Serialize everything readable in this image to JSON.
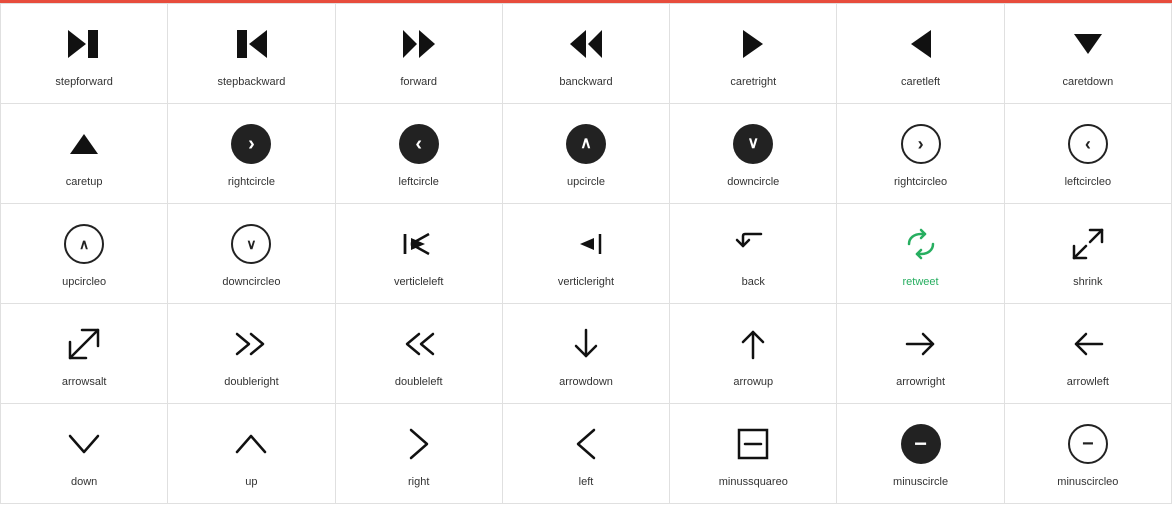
{
  "icons": [
    {
      "id": "stepforward",
      "label": "stepforward",
      "type": "text",
      "symbol": "⏭",
      "unicode": "&#x23ED;"
    },
    {
      "id": "stepbackward",
      "label": "stepbackward",
      "type": "text",
      "symbol": "⏮",
      "unicode": "&#x23EE;"
    },
    {
      "id": "forward",
      "label": "forward",
      "type": "text",
      "symbol": "⏩",
      "unicode": "&#x23E9;"
    },
    {
      "id": "banckward",
      "label": "banckward",
      "type": "text",
      "symbol": "⏪",
      "unicode": "&#x23EA;"
    },
    {
      "id": "caretright",
      "label": "caretright",
      "type": "text",
      "symbol": "▶",
      "unicode": "&#x25B6;"
    },
    {
      "id": "caretleft",
      "label": "caretleft",
      "type": "text",
      "symbol": "◀",
      "unicode": "&#x25C0;"
    },
    {
      "id": "caretdown",
      "label": "caretdown",
      "type": "text",
      "symbol": "▼",
      "unicode": "&#x25BC;"
    },
    {
      "id": "caretup",
      "label": "caretup",
      "type": "text",
      "symbol": "▲",
      "unicode": "&#x25B2;"
    },
    {
      "id": "rightcircle",
      "label": "rightcircle",
      "type": "filled-circle",
      "symbol": "❯"
    },
    {
      "id": "leftcircle",
      "label": "leftcircle",
      "type": "filled-circle",
      "symbol": "❮"
    },
    {
      "id": "upcircle",
      "label": "upcircle",
      "type": "filled-circle",
      "symbol": "❮",
      "rotate": "-90"
    },
    {
      "id": "downcircle",
      "label": "downcircle",
      "type": "filled-circle",
      "symbol": "❯",
      "rotate": "90"
    },
    {
      "id": "rightcircleo",
      "label": "rightcircleo",
      "type": "outline-circle",
      "symbol": "❯"
    },
    {
      "id": "leftcircleo",
      "label": "leftcircleo",
      "type": "outline-circle",
      "symbol": "❮"
    },
    {
      "id": "upcircleo",
      "label": "upcircleo",
      "type": "outline-circle",
      "symbol": "∧"
    },
    {
      "id": "downcircleo",
      "label": "downcircleo",
      "type": "outline-circle",
      "symbol": "∨"
    },
    {
      "id": "verticleleft",
      "label": "verticleleft",
      "type": "text",
      "symbol": "⇤"
    },
    {
      "id": "verticleright",
      "label": "verticleright",
      "type": "text",
      "symbol": "⇥"
    },
    {
      "id": "back",
      "label": "back",
      "type": "text",
      "symbol": "↩"
    },
    {
      "id": "retweet",
      "label": "retweet",
      "type": "retweet",
      "symbol": "↺"
    },
    {
      "id": "shrink",
      "label": "shrink",
      "type": "text",
      "symbol": "⤡"
    },
    {
      "id": "arrowsalt",
      "label": "arrowsalt",
      "type": "text",
      "symbol": "⤢"
    },
    {
      "id": "doubleright",
      "label": "doubleright",
      "type": "text",
      "symbol": "»"
    },
    {
      "id": "doubleleft",
      "label": "doubleleft",
      "type": "text",
      "symbol": "«"
    },
    {
      "id": "arrowdown",
      "label": "arrowdown",
      "type": "text",
      "symbol": "↓"
    },
    {
      "id": "arrowup",
      "label": "arrowup",
      "type": "text",
      "symbol": "↑"
    },
    {
      "id": "arrowright",
      "label": "arrowright",
      "type": "text",
      "symbol": "→"
    },
    {
      "id": "arrowleft",
      "label": "arrowleft",
      "type": "text",
      "symbol": "←"
    },
    {
      "id": "down",
      "label": "down",
      "type": "text",
      "symbol": "∨"
    },
    {
      "id": "up",
      "label": "up",
      "type": "text",
      "symbol": "∧"
    },
    {
      "id": "right",
      "label": "right",
      "type": "text",
      "symbol": ">"
    },
    {
      "id": "left",
      "label": "left",
      "type": "text",
      "symbol": "<"
    },
    {
      "id": "minussquareo",
      "label": "minussquareo",
      "type": "text",
      "symbol": "⊟"
    },
    {
      "id": "minuscircle",
      "label": "minuscircle",
      "type": "filled-circle-minus",
      "symbol": "−"
    },
    {
      "id": "minuscircleo",
      "label": "minuscircleo",
      "type": "outline-circle",
      "symbol": "−"
    }
  ]
}
